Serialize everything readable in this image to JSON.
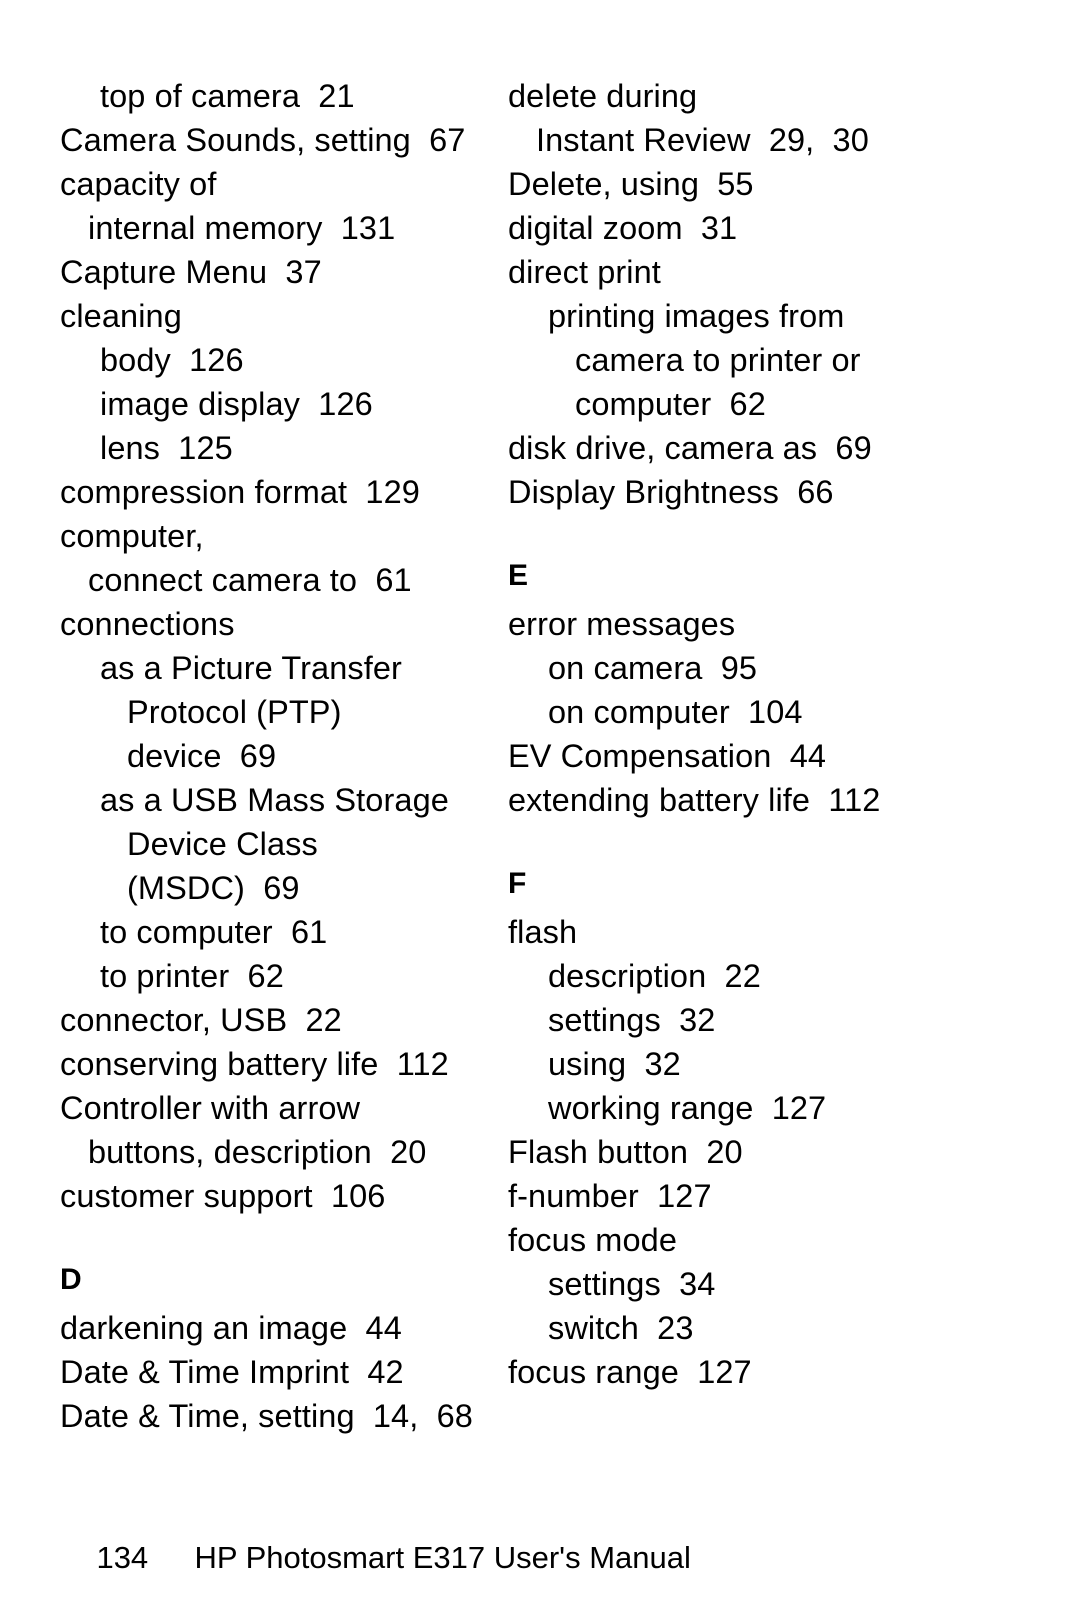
{
  "page": {
    "number": "134",
    "footer_title": "HP Photosmart E317 User's Manual"
  },
  "columns": {
    "left": [
      {
        "type": "entry",
        "indent": 2,
        "text": "top of camera  21"
      },
      {
        "type": "entry",
        "indent": 0,
        "text": "Camera Sounds, setting  67"
      },
      {
        "type": "entry",
        "indent": 0,
        "text": "capacity of"
      },
      {
        "type": "entry",
        "indent": 1,
        "text": "internal memory  131"
      },
      {
        "type": "entry",
        "indent": 0,
        "text": "Capture Menu  37"
      },
      {
        "type": "entry",
        "indent": 0,
        "text": "cleaning"
      },
      {
        "type": "entry",
        "indent": 2,
        "text": "body  126"
      },
      {
        "type": "entry",
        "indent": 2,
        "text": "image display  126"
      },
      {
        "type": "entry",
        "indent": 2,
        "text": "lens  125"
      },
      {
        "type": "entry",
        "indent": 0,
        "text": "compression format  129"
      },
      {
        "type": "entry",
        "indent": 0,
        "text": "computer,"
      },
      {
        "type": "entry",
        "indent": 1,
        "text": "connect camera to  61"
      },
      {
        "type": "entry",
        "indent": 0,
        "text": "connections"
      },
      {
        "type": "entry",
        "indent": 2,
        "text": "as a Picture Transfer"
      },
      {
        "type": "entry",
        "indent": 3,
        "text": "Protocol (PTP)"
      },
      {
        "type": "entry",
        "indent": 3,
        "text": "device  69"
      },
      {
        "type": "entry",
        "indent": 2,
        "text": "as a USB Mass Storage"
      },
      {
        "type": "entry",
        "indent": 3,
        "text": "Device Class"
      },
      {
        "type": "entry",
        "indent": 3,
        "text": "(MSDC)  69"
      },
      {
        "type": "entry",
        "indent": 2,
        "text": "to computer  61"
      },
      {
        "type": "entry",
        "indent": 2,
        "text": "to printer  62"
      },
      {
        "type": "entry",
        "indent": 0,
        "text": "connector, USB  22"
      },
      {
        "type": "entry",
        "indent": 0,
        "text": "conserving battery life  112"
      },
      {
        "type": "entry",
        "indent": 0,
        "text": "Controller with arrow"
      },
      {
        "type": "entry",
        "indent": 1,
        "text": "buttons, description  20"
      },
      {
        "type": "entry",
        "indent": 0,
        "text": "customer support  106"
      },
      {
        "type": "heading",
        "indent": 0,
        "text": "D"
      },
      {
        "type": "entry",
        "indent": 0,
        "text": "darkening an image  44"
      },
      {
        "type": "entry",
        "indent": 0,
        "text": "Date & Time Imprint  42"
      },
      {
        "type": "entry",
        "indent": 0,
        "text": "Date & Time, setting  14,  68"
      }
    ],
    "right": [
      {
        "type": "entry",
        "indent": 0,
        "text": "delete during"
      },
      {
        "type": "entry",
        "indent": 1,
        "text": "Instant Review  29,  30"
      },
      {
        "type": "entry",
        "indent": 0,
        "text": "Delete, using  55"
      },
      {
        "type": "entry",
        "indent": 0,
        "text": "digital zoom  31"
      },
      {
        "type": "entry",
        "indent": 0,
        "text": "direct print"
      },
      {
        "type": "entry",
        "indent": 2,
        "text": "printing images from"
      },
      {
        "type": "entry",
        "indent": 3,
        "text": "camera to printer or"
      },
      {
        "type": "entry",
        "indent": 3,
        "text": "computer  62"
      },
      {
        "type": "entry",
        "indent": 0,
        "text": "disk drive, camera as  69"
      },
      {
        "type": "entry",
        "indent": 0,
        "text": "Display Brightness  66"
      },
      {
        "type": "heading",
        "indent": 0,
        "text": "E"
      },
      {
        "type": "entry",
        "indent": 0,
        "text": "error messages"
      },
      {
        "type": "entry",
        "indent": 2,
        "text": "on camera  95"
      },
      {
        "type": "entry",
        "indent": 2,
        "text": "on computer  104"
      },
      {
        "type": "entry",
        "indent": 0,
        "text": "EV Compensation  44"
      },
      {
        "type": "entry",
        "indent": 0,
        "text": "extending battery life  112"
      },
      {
        "type": "heading",
        "indent": 0,
        "text": "F"
      },
      {
        "type": "entry",
        "indent": 0,
        "text": "flash"
      },
      {
        "type": "entry",
        "indent": 2,
        "text": "description  22"
      },
      {
        "type": "entry",
        "indent": 2,
        "text": "settings  32"
      },
      {
        "type": "entry",
        "indent": 2,
        "text": "using  32"
      },
      {
        "type": "entry",
        "indent": 2,
        "text": "working range  127"
      },
      {
        "type": "entry",
        "indent": 0,
        "text": "Flash button  20"
      },
      {
        "type": "entry",
        "indent": 0,
        "text": "f-number  127"
      },
      {
        "type": "entry",
        "indent": 0,
        "text": "focus mode"
      },
      {
        "type": "entry",
        "indent": 2,
        "text": "settings  34"
      },
      {
        "type": "entry",
        "indent": 2,
        "text": "switch  23"
      },
      {
        "type": "entry",
        "indent": 0,
        "text": "focus range  127"
      }
    ]
  }
}
